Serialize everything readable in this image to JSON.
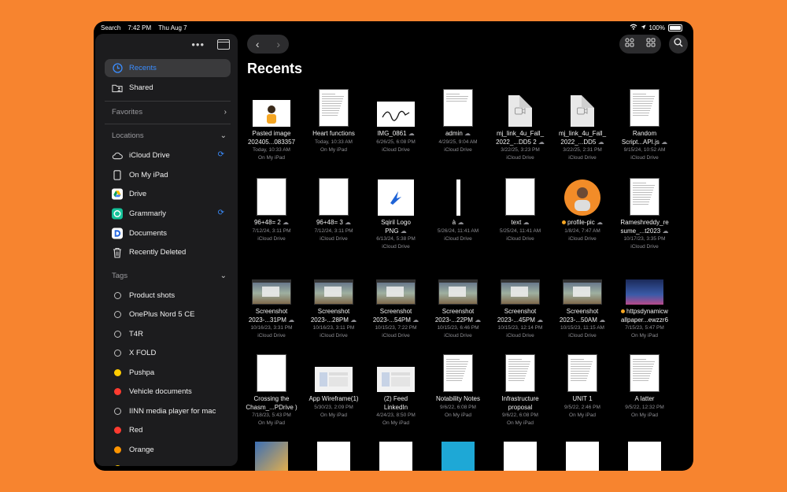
{
  "status": {
    "left": "Search",
    "time": "7:42 PM",
    "date": "Thu Aug 7",
    "battery": "100%"
  },
  "sidebar": {
    "items": [
      {
        "label": "Recents",
        "icon": "clock-icon",
        "active": true
      },
      {
        "label": "Shared",
        "icon": "shared-folder-icon"
      }
    ],
    "favorites": "Favorites",
    "locations_title": "Locations",
    "locations": [
      {
        "label": "iCloud Drive",
        "icon": "cloud-icon",
        "sync": true
      },
      {
        "label": "On My iPad",
        "icon": "ipad-icon"
      },
      {
        "label": "Drive",
        "icon": "google-drive-icon"
      },
      {
        "label": "Grammarly",
        "icon": "grammarly-icon",
        "sync": true
      },
      {
        "label": "Documents",
        "icon": "documents-app-icon"
      },
      {
        "label": "Recently Deleted",
        "icon": "trash-icon"
      }
    ],
    "tags_title": "Tags",
    "tags": [
      {
        "label": "Product shots",
        "color": ""
      },
      {
        "label": "OnePlus Nord 5 CE",
        "color": ""
      },
      {
        "label": "T4R",
        "color": ""
      },
      {
        "label": "X FOLD",
        "color": ""
      },
      {
        "label": "Pushpa",
        "color": "#FFCC00"
      },
      {
        "label": "Vehicle documents",
        "color": "#FF3B30"
      },
      {
        "label": "IINN media player for mac",
        "color": ""
      },
      {
        "label": "Red",
        "color": "#FF3B30"
      },
      {
        "label": "Orange",
        "color": "#FF9500"
      }
    ]
  },
  "main": {
    "title": "Recents",
    "files": [
      {
        "name": "Pasted image\n202405...083357",
        "date": "Today, 10:33 AM",
        "loc": "On My iPad",
        "kind": "img-person",
        "cloud": false
      },
      {
        "name": "Heart functions",
        "date": "Today, 10:33 AM",
        "loc": "On My iPad",
        "kind": "doc",
        "cloud": false
      },
      {
        "name": "IMG_0861",
        "date": "6/26/25, 6:08 PM",
        "loc": "iCloud Drive",
        "kind": "signature",
        "cloud": true
      },
      {
        "name": "admin",
        "date": "4/29/25, 9:04 AM",
        "loc": "iCloud Drive",
        "kind": "sketch",
        "cloud": true
      },
      {
        "name": "mj_link_4u_Fall_\n2022_...DD5 2",
        "date": "3/22/25, 3:23 PM",
        "loc": "iCloud Drive",
        "kind": "video",
        "cloud": true
      },
      {
        "name": "mj_link_4u_Fall_\n2022_...DD5",
        "date": "3/22/25, 2:31 PM",
        "loc": "iCloud Drive",
        "kind": "video",
        "cloud": true
      },
      {
        "name": "Random\nScript...API.js",
        "date": "9/15/24, 10:52 AM",
        "loc": "iCloud Drive",
        "kind": "doc",
        "cloud": true
      },
      {
        "name": "96+48= 2",
        "date": "7/12/24, 3:11 PM",
        "loc": "iCloud Drive",
        "kind": "blank",
        "cloud": true
      },
      {
        "name": "96+48= 3",
        "date": "7/12/24, 3:11 PM",
        "loc": "iCloud Drive",
        "kind": "blank",
        "cloud": true
      },
      {
        "name": "Sqiril Logo\nPNG",
        "date": "6/13/24, 5:38 PM",
        "loc": "iCloud Drive",
        "kind": "logo",
        "cloud": true
      },
      {
        "name": "à",
        "date": "5/26/24, 11:41 AM",
        "loc": "iCloud Drive",
        "kind": "thin",
        "cloud": true
      },
      {
        "name": "text",
        "date": "5/25/24, 11:41 AM",
        "loc": "iCloud Drive",
        "kind": "blank",
        "cloud": true
      },
      {
        "name": "profile-pic",
        "date": "1/8/24, 7:47 AM",
        "loc": "iCloud Drive",
        "kind": "profile",
        "cloud": true,
        "tagdot": true
      },
      {
        "name": "Rameshreddy_re\nsume_...t2023",
        "date": "10/17/23, 3:35 PM",
        "loc": "iCloud Drive",
        "kind": "doc",
        "cloud": true
      },
      {
        "name": "Screenshot\n2023-...31PM",
        "date": "10/16/23, 3:31 PM",
        "loc": "iCloud Drive",
        "kind": "shot",
        "cloud": true
      },
      {
        "name": "Screenshot\n2023-...28PM",
        "date": "10/16/23, 3:11 PM",
        "loc": "iCloud Drive",
        "kind": "shot",
        "cloud": true
      },
      {
        "name": "Screenshot\n2023-...54PM",
        "date": "10/15/23, 7:22 PM",
        "loc": "iCloud Drive",
        "kind": "shot",
        "cloud": true
      },
      {
        "name": "Screenshot\n2023-...22PM",
        "date": "10/15/23, 6:46 PM",
        "loc": "iCloud Drive",
        "kind": "shot",
        "cloud": true
      },
      {
        "name": "Screenshot\n2023-...45PM",
        "date": "10/15/23, 12:14 PM",
        "loc": "iCloud Drive",
        "kind": "shot",
        "cloud": true
      },
      {
        "name": "Screenshot\n2023-...50AM",
        "date": "10/15/23, 11:15 AM",
        "loc": "iCloud Drive",
        "kind": "shot",
        "cloud": true
      },
      {
        "name": "httpsdynamicw\nallpaper...ewzzr6",
        "date": "7/15/23, 5:47 PM",
        "loc": "On My iPad",
        "kind": "wallpaper",
        "cloud": false,
        "tagdot": true
      },
      {
        "name": "Crossing the\nChasm_...PDrive )",
        "date": "7/18/23, 5:43 PM",
        "loc": "On My iPad",
        "kind": "blank",
        "cloud": false
      },
      {
        "name": "App Wireframe(1)",
        "date": "5/30/23, 2:09 PM",
        "loc": "On My iPad",
        "kind": "wire",
        "cloud": false
      },
      {
        "name": "(2) Feed\nLinkedIn",
        "date": "4/24/23, 8:50 PM",
        "loc": "On My iPad",
        "kind": "wire",
        "cloud": false
      },
      {
        "name": "Notability Notes",
        "date": "9/6/22, 6:08 PM",
        "loc": "On My iPad",
        "kind": "doc",
        "cloud": false
      },
      {
        "name": "Infrastructure\nproposal",
        "date": "9/6/22, 6:08 PM",
        "loc": "On My iPad",
        "kind": "doc",
        "cloud": false
      },
      {
        "name": "UNIT 1",
        "date": "9/5/22, 2:46 PM",
        "loc": "On My iPad",
        "kind": "doc",
        "cloud": false
      },
      {
        "name": "A latter",
        "date": "9/5/22, 12:32 PM",
        "loc": "On My iPad",
        "kind": "doc",
        "cloud": false
      }
    ]
  },
  "icons": {
    "more": "ellipsis-icon",
    "sidebar": "sidebar-toggle-icon",
    "back": "chevron-left-icon",
    "forward": "chevron-right-icon",
    "group": "group-icon",
    "grid": "grid-icon",
    "search": "search-icon"
  }
}
